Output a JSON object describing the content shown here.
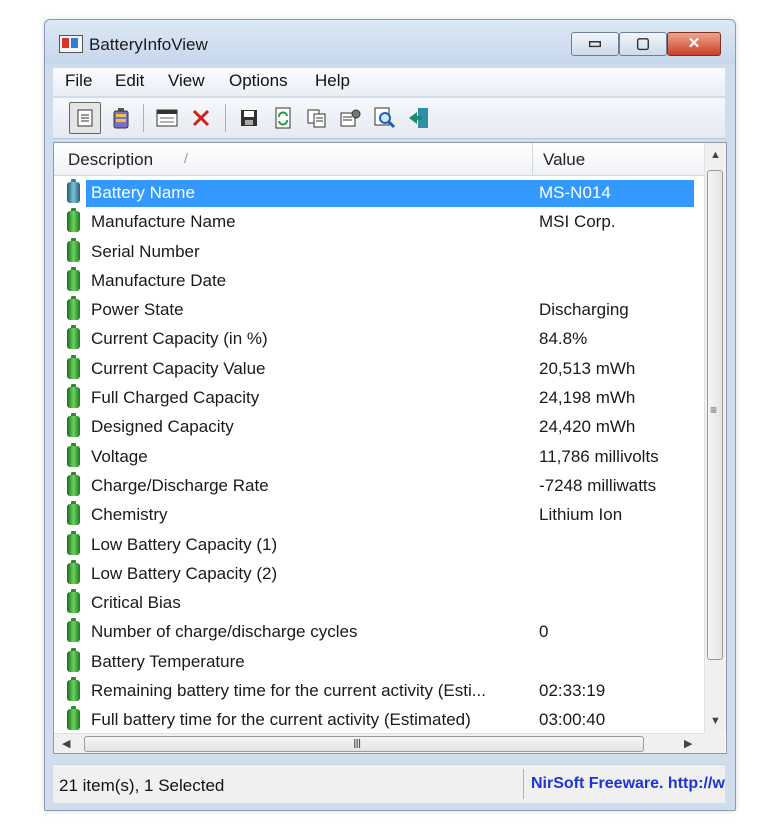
{
  "window": {
    "title": "BatteryInfoView"
  },
  "window_buttons": {
    "minimize": "▭",
    "maximize": "▢",
    "close": "✕"
  },
  "menu": [
    "File",
    "Edit",
    "View",
    "Options",
    "Help"
  ],
  "toolbar": {
    "icons": [
      "report-icon",
      "battery-icon",
      "properties-window-icon",
      "delete-icon",
      "save-icon",
      "refresh-icon",
      "copy-icon",
      "options-icon",
      "find-icon",
      "exit-icon"
    ]
  },
  "list": {
    "columns": [
      "Description",
      "Value"
    ],
    "sort_column": "Description",
    "rows": [
      {
        "desc": "Battery Name",
        "value": "MS-N014",
        "selected": true
      },
      {
        "desc": "Manufacture Name",
        "value": "MSI Corp."
      },
      {
        "desc": "Serial Number",
        "value": ""
      },
      {
        "desc": "Manufacture Date",
        "value": ""
      },
      {
        "desc": "Power State",
        "value": "Discharging"
      },
      {
        "desc": "Current Capacity (in %)",
        "value": "84.8%"
      },
      {
        "desc": "Current Capacity Value",
        "value": "20,513 mWh"
      },
      {
        "desc": "Full Charged Capacity",
        "value": "24,198 mWh"
      },
      {
        "desc": "Designed Capacity",
        "value": "24,420 mWh"
      },
      {
        "desc": "Voltage",
        "value": "11,786 millivolts"
      },
      {
        "desc": "Charge/Discharge Rate",
        "value": "-7248 milliwatts"
      },
      {
        "desc": "Chemistry",
        "value": "Lithium Ion"
      },
      {
        "desc": "Low Battery Capacity (1)",
        "value": ""
      },
      {
        "desc": "Low Battery Capacity (2)",
        "value": ""
      },
      {
        "desc": "Critical Bias",
        "value": ""
      },
      {
        "desc": "Number of charge/discharge cycles",
        "value": "0"
      },
      {
        "desc": "Battery Temperature",
        "value": ""
      },
      {
        "desc": "Remaining battery time for the current activity (Esti...",
        "value": "02:33:19"
      },
      {
        "desc": "Full battery time for the current activity (Estimated)",
        "value": "03:00:40"
      }
    ]
  },
  "status": {
    "items": "21 item(s), 1 Selected",
    "credit": "NirSoft Freeware.  http://www.nirsoft.net"
  }
}
